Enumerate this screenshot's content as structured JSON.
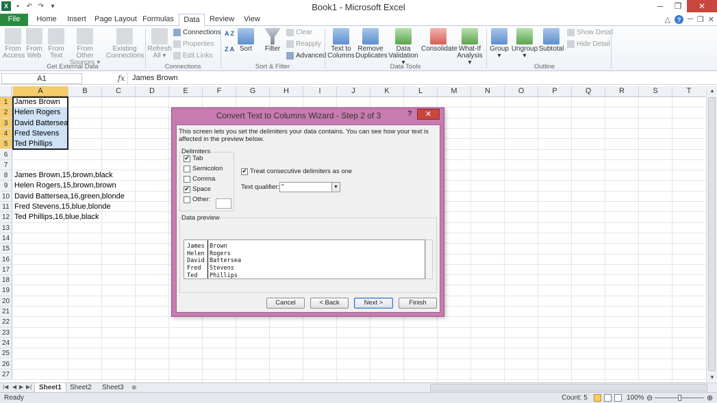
{
  "app": {
    "title": "Book1 - Microsoft Excel",
    "logo": "X"
  },
  "tabs": [
    "File",
    "Home",
    "Insert",
    "Page Layout",
    "Formulas",
    "Data",
    "Review",
    "View"
  ],
  "active_tab": "Data",
  "ribbon": {
    "get_external_data": {
      "label": "Get External Data",
      "buttons": [
        {
          "line1": "From",
          "line2": "Access"
        },
        {
          "line1": "From",
          "line2": "Web"
        },
        {
          "line1": "From",
          "line2": "Text"
        },
        {
          "line1": "From Other",
          "line2": "Sources ▾"
        },
        {
          "line1": "Existing",
          "line2": "Connections"
        }
      ]
    },
    "connections": {
      "label": "Connections",
      "refresh": {
        "line1": "Refresh",
        "line2": "All ▾"
      },
      "items": [
        "Connections",
        "Properties",
        "Edit Links"
      ]
    },
    "sort_filter": {
      "label": "Sort & Filter",
      "sort": "Sort",
      "filter": "Filter",
      "clear": "Clear",
      "reapply": "Reapply",
      "advanced": "Advanced",
      "az": "A Z",
      "za": "Z A"
    },
    "data_tools": {
      "label": "Data Tools",
      "buttons": [
        {
          "line1": "Text to",
          "line2": "Columns"
        },
        {
          "line1": "Remove",
          "line2": "Duplicates"
        },
        {
          "line1": "Data",
          "line2": "Validation ▾"
        },
        {
          "line1": "Consolidate",
          "line2": ""
        },
        {
          "line1": "What-If",
          "line2": "Analysis ▾"
        }
      ]
    },
    "outline": {
      "label": "Outline",
      "buttons": [
        {
          "line1": "Group",
          "line2": "▾"
        },
        {
          "line1": "Ungroup",
          "line2": "▾"
        },
        {
          "line1": "Subtotal",
          "line2": ""
        }
      ],
      "show_detail": "Show Detail",
      "hide_detail": "Hide Detail"
    }
  },
  "formula_bar": {
    "name_box": "A1",
    "fx": "fx",
    "content": "James Brown"
  },
  "columns": [
    "A",
    "B",
    "C",
    "D",
    "E",
    "F",
    "G",
    "H",
    "I",
    "J",
    "K",
    "L",
    "M",
    "N",
    "O",
    "P",
    "Q",
    "R",
    "S",
    "T"
  ],
  "selected_column": "A",
  "rows": [
    "1",
    "2",
    "3",
    "4",
    "5",
    "6",
    "7",
    "8",
    "9",
    "10",
    "11",
    "12",
    "13",
    "14",
    "15",
    "16",
    "17",
    "18",
    "19",
    "20",
    "21",
    "22",
    "23",
    "24",
    "25",
    "26",
    "27"
  ],
  "cells": [
    {
      "row": 1,
      "text": "James Brown"
    },
    {
      "row": 2,
      "text": "Helen Rogers"
    },
    {
      "row": 3,
      "text": "David Battersea"
    },
    {
      "row": 4,
      "text": "Fred Stevens"
    },
    {
      "row": 5,
      "text": "Ted Phillips"
    },
    {
      "row": 8,
      "text": "James Brown,15,brown,black"
    },
    {
      "row": 9,
      "text": "Helen Rogers,15,brown,brown"
    },
    {
      "row": 10,
      "text": "David Battersea,16,green,blonde"
    },
    {
      "row": 11,
      "text": "Fred Stevens,15,blue,blonde"
    },
    {
      "row": 12,
      "text": "Ted Phillips,16,blue,black"
    }
  ],
  "sheets": [
    "Sheet1",
    "Sheet2",
    "Sheet3"
  ],
  "active_sheet": "Sheet1",
  "status": {
    "ready": "Ready",
    "count": "Count: 5",
    "zoom": "100%"
  },
  "dialog": {
    "title": "Convert Text to Columns Wizard - Step 2 of 3",
    "help": "?",
    "close": "✕",
    "intro": "This screen lets you set the delimiters your data contains.  You can see how your text is affected in the preview below.",
    "delimiters_label": "Delimiters",
    "delimiters": [
      {
        "label": "Tab",
        "checked": true
      },
      {
        "label": "Semicolon",
        "checked": false
      },
      {
        "label": "Comma",
        "checked": false
      },
      {
        "label": "Space",
        "checked": true
      },
      {
        "label": "Other:",
        "checked": false
      }
    ],
    "consecutive": {
      "label": "Treat consecutive delimiters as one",
      "checked": true
    },
    "qualifier_label": "Text qualifier:",
    "qualifier_value": "\"",
    "preview_label": "Data preview",
    "preview_rows": [
      [
        "James",
        "Brown"
      ],
      [
        "Helen",
        "Rogers"
      ],
      [
        "David",
        "Battersea"
      ],
      [
        "Fred",
        "Stevens"
      ],
      [
        "Ted",
        "Phillips"
      ]
    ],
    "buttons": {
      "cancel": "Cancel",
      "back": "< Back",
      "next": "Next >",
      "finish": "Finish"
    }
  }
}
